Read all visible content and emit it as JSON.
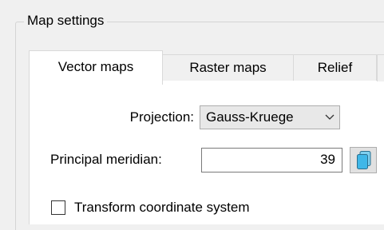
{
  "group": {
    "title": "Map settings"
  },
  "tabs": [
    {
      "label": "Vector maps",
      "active": true
    },
    {
      "label": "Raster maps",
      "active": false
    },
    {
      "label": "Relief",
      "active": false
    }
  ],
  "projection": {
    "label": "Projection:",
    "value": "Gauss-Kruege",
    "icon": "chevron-down-icon"
  },
  "meridian": {
    "label": "Principal meridian:",
    "value": "39",
    "button_icon": "copy-icon"
  },
  "transform": {
    "label": "Transform coordinate system",
    "checked": false
  },
  "colors": {
    "panel_bg": "#f0f0f0",
    "tab_active_bg": "#ffffff",
    "copy_icon_fill": "#3fb7e8"
  }
}
